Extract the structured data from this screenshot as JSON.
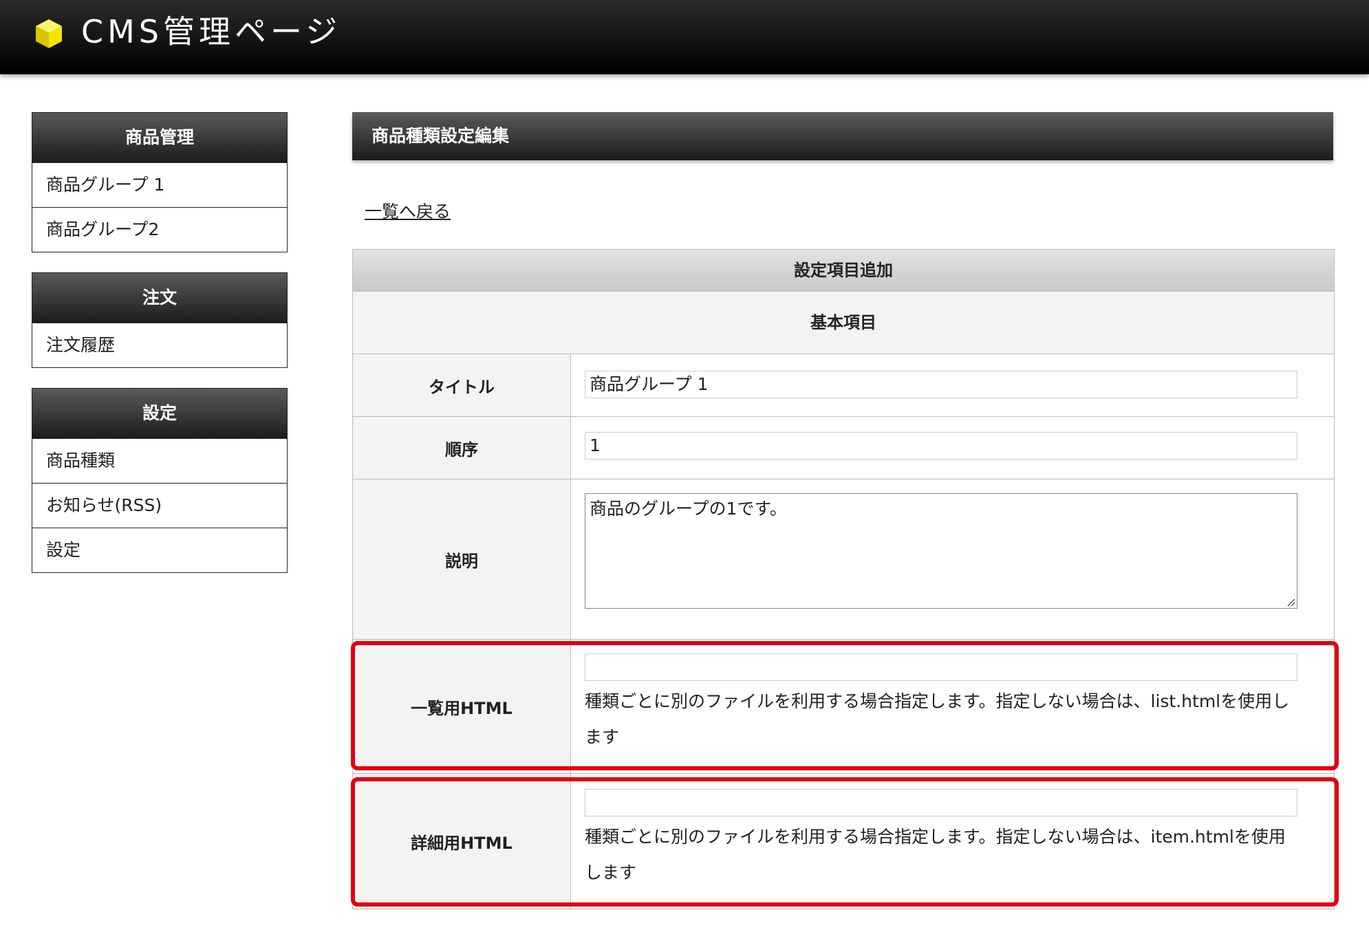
{
  "header": {
    "title": "CMS管理ページ"
  },
  "sidebar": {
    "groups": [
      {
        "title": "商品管理",
        "items": [
          "商品グループ 1",
          "商品グループ2"
        ]
      },
      {
        "title": "注文",
        "items": [
          "注文履歴"
        ]
      },
      {
        "title": "設定",
        "items": [
          "商品種類",
          "お知らせ(RSS)",
          "設定"
        ]
      }
    ]
  },
  "main": {
    "title": "商品種類設定編集",
    "back_link": "一覧へ戻る",
    "section_title": "設定項目追加",
    "subsection_title": "基本項目",
    "fields": {
      "title": {
        "label": "タイトル",
        "value": "商品グループ 1"
      },
      "order": {
        "label": "順序",
        "value": "1"
      },
      "description": {
        "label": "説明",
        "value": "商品のグループの1です。"
      },
      "list_html": {
        "label": "一覧用HTML",
        "value": "",
        "note_line1": "種類ごとに別のファイルを利用する場合指定します。指定しない場合は、list.htmlを使用し",
        "note_line2": "ます"
      },
      "detail_html": {
        "label": "詳細用HTML",
        "value": "",
        "note_line1": "種類ごとに別のファイルを利用する場合指定します。指定しない場合は、item.htmlを使用",
        "note_line2": "します"
      }
    }
  },
  "colors": {
    "highlight": "#e0000f",
    "logo": "#f2e600"
  },
  "icons": [
    "logo-cube-icon",
    "resize-grip-icon"
  ]
}
